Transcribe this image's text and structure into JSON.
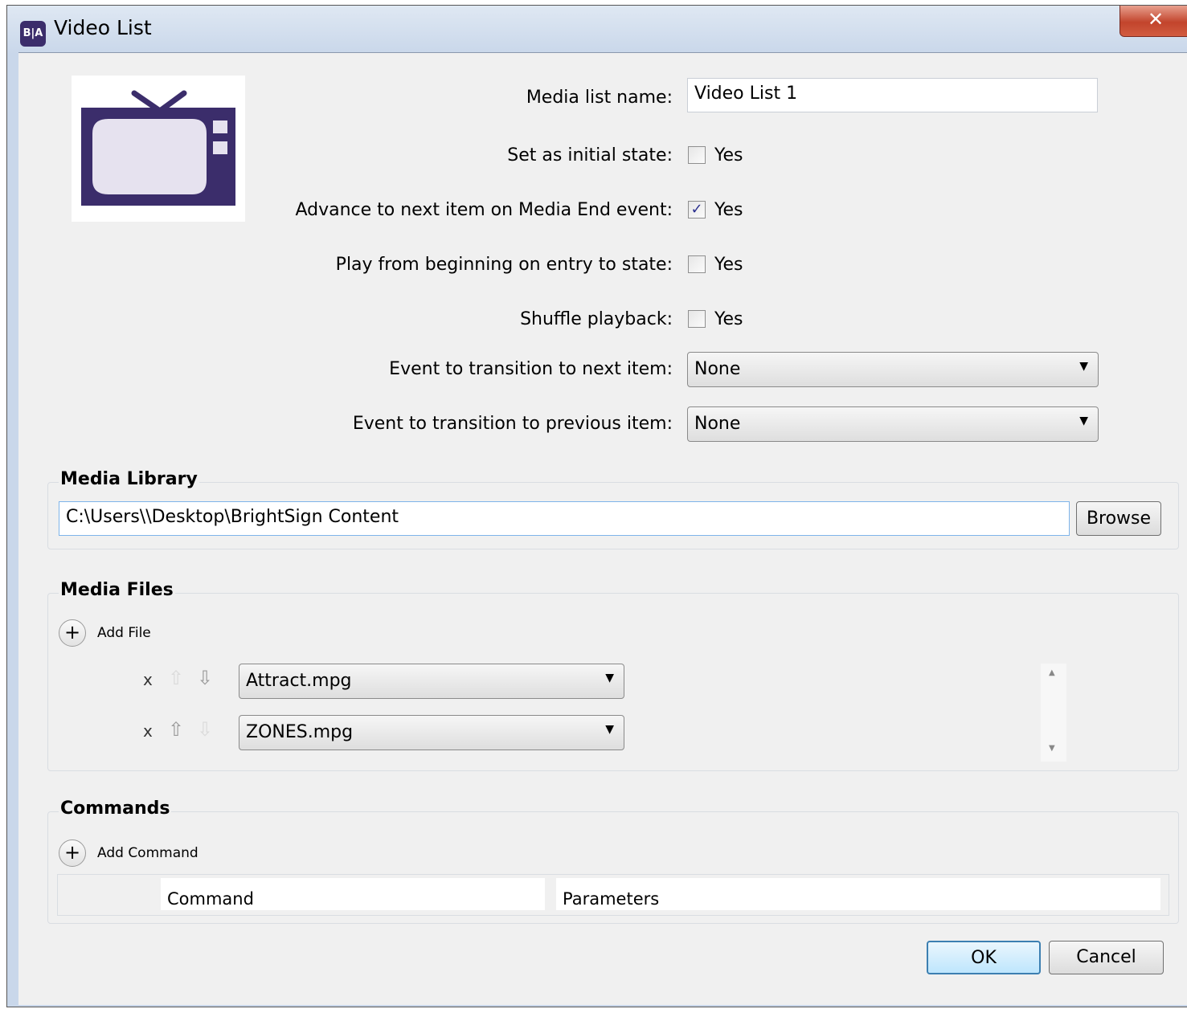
{
  "window": {
    "title": "Video List",
    "app_icon_text": "B|A",
    "close_glyph": "✕"
  },
  "form": {
    "media_list_name": {
      "label": "Media list name:",
      "value": "Video List 1"
    },
    "initial_state": {
      "label": "Set as initial state:",
      "checked": false,
      "option": "Yes"
    },
    "advance_next": {
      "label": "Advance to next item on Media End event:",
      "checked": true,
      "option": "Yes",
      "check_glyph": "✓"
    },
    "play_from_beginning": {
      "label": "Play from beginning on entry to state:",
      "checked": false,
      "option": "Yes"
    },
    "shuffle": {
      "label": "Shuffle playback:",
      "checked": false,
      "option": "Yes"
    },
    "next_event": {
      "label": "Event to transition to next item:",
      "value": "None"
    },
    "prev_event": {
      "label": "Event to transition to previous item:",
      "value": "None"
    }
  },
  "media_library": {
    "title": "Media Library",
    "path": "C:\\Users\\\\Desktop\\BrightSign Content",
    "browse_label": "Browse"
  },
  "media_files": {
    "title": "Media Files",
    "add_label": "Add File",
    "items": [
      {
        "remove": "x",
        "file": "Attract.mpg",
        "up_enabled": false,
        "down_enabled": true
      },
      {
        "remove": "x",
        "file": "ZONES.mpg",
        "up_enabled": true,
        "down_enabled": false
      }
    ]
  },
  "commands": {
    "title": "Commands",
    "add_label": "Add Command",
    "columns": [
      "Command",
      "Parameters"
    ]
  },
  "buttons": {
    "ok": "OK",
    "cancel": "Cancel"
  },
  "icons": {
    "dropdown": "▼",
    "up": "⇧",
    "down": "⇩",
    "plus": "+",
    "scroll_up": "▲",
    "scroll_down": "▼"
  },
  "colors": {
    "tv_icon": "#3b2d6b",
    "ok_border": "#3c7fb1"
  }
}
